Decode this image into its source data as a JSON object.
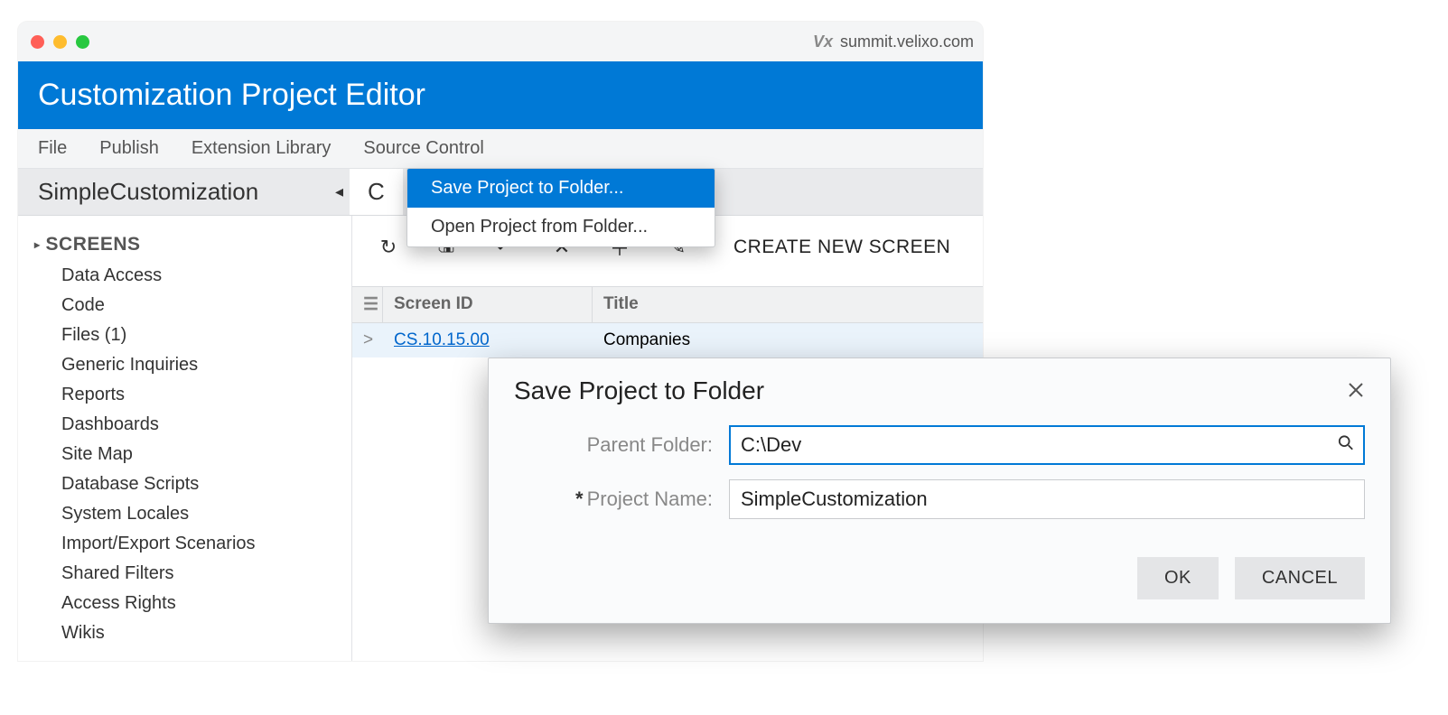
{
  "browser": {
    "vx": "Vx",
    "url": "summit.velixo.com"
  },
  "banner_title": "Customization Project Editor",
  "menus": {
    "file": "File",
    "publish": "Publish",
    "ext": "Extension Library",
    "src": "Source Control"
  },
  "project_name": "SimpleCustomization",
  "collapse_glyph": "◂",
  "current_tab_initial": "C",
  "sidebar": {
    "category": "SCREENS",
    "items": [
      "Data Access",
      "Code",
      "Files (1)",
      "Generic Inquiries",
      "Reports",
      "Dashboards",
      "Site Map",
      "Database Scripts",
      "System Locales",
      "Import/Export Scenarios",
      "Shared Filters",
      "Access Rights",
      "Wikis"
    ]
  },
  "main": {
    "create_new": "CREATE NEW SCREEN",
    "grid": {
      "col_selector_glyph": "☰",
      "row_indicator_glyph": ">",
      "cols": {
        "screen_id": "Screen ID",
        "title": "Title"
      },
      "row": {
        "screen_id": "CS.10.15.00",
        "title": "Companies"
      }
    }
  },
  "dropdown": {
    "save": "Save Project to Folder...",
    "open": "Open Project from Folder..."
  },
  "toolbar": {
    "refresh": "↻",
    "save": "🖫",
    "undo": "↶",
    "close": "✕",
    "add": "＋",
    "edit": "✎"
  },
  "dialog": {
    "title": "Save Project to Folder",
    "parent_label": "Parent Folder:",
    "parent_value": "C:\\Dev",
    "project_label": "Project Name:",
    "project_value": "SimpleCustomization",
    "ok": "OK",
    "cancel": "CANCEL"
  }
}
